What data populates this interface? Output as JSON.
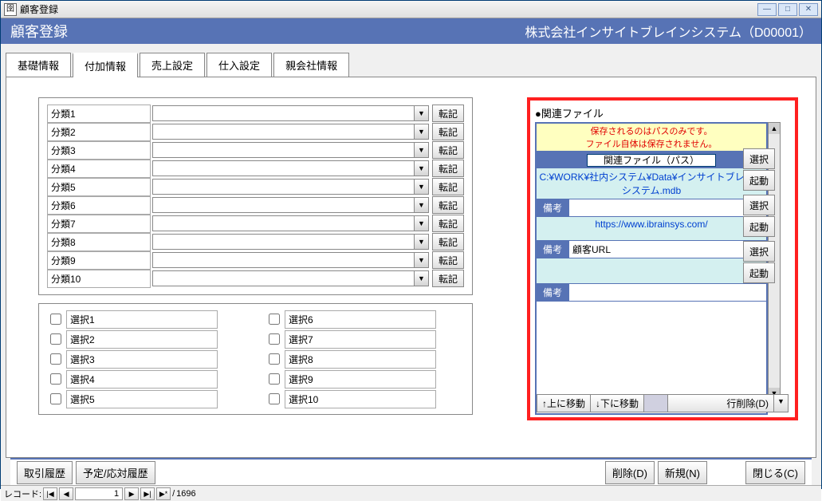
{
  "window": {
    "icon_glyph": "囹",
    "title": "顧客登録",
    "min_glyph": "—",
    "max_glyph": "□",
    "close_glyph": "✕"
  },
  "banner": {
    "title": "顧客登録",
    "company": "株式会社インサイトブレインシステム（D00001）"
  },
  "tabs": [
    {
      "label": "基礎情報"
    },
    {
      "label": "付加情報"
    },
    {
      "label": "売上設定"
    },
    {
      "label": "仕入設定"
    },
    {
      "label": "親会社情報"
    }
  ],
  "active_tab_index": 1,
  "classifications": [
    {
      "label": "分類1",
      "value": ""
    },
    {
      "label": "分類2",
      "value": ""
    },
    {
      "label": "分類3",
      "value": ""
    },
    {
      "label": "分類4",
      "value": ""
    },
    {
      "label": "分類5",
      "value": ""
    },
    {
      "label": "分類6",
      "value": ""
    },
    {
      "label": "分類7",
      "value": ""
    },
    {
      "label": "分類8",
      "value": ""
    },
    {
      "label": "分類9",
      "value": ""
    },
    {
      "label": "分類10",
      "value": ""
    }
  ],
  "tenki_label": "転記",
  "selections": {
    "left": [
      "選択1",
      "選択2",
      "選択3",
      "選択4",
      "選択5"
    ],
    "right": [
      "選択6",
      "選択7",
      "選択8",
      "選択9",
      "選択10"
    ]
  },
  "related": {
    "header": "●関連ファイル",
    "warn1": "保存されるのはパスのみです。",
    "warn2": "ファイル自体は保存されません。",
    "col_header": "関連ファイル（パス）",
    "rows": [
      {
        "path": "C:¥WORK¥社内システム¥Data¥インサイトブレインシステム.mdb",
        "biko_label": "備考",
        "biko": ""
      },
      {
        "path": "https://www.ibrainsys.com/",
        "biko_label": "備考",
        "biko": "顧客URL"
      },
      {
        "path": "",
        "biko_label": "備考",
        "biko": ""
      }
    ],
    "side_buttons": {
      "select": "選択",
      "launch": "起動"
    },
    "bottom": {
      "move_up": "↑上に移動",
      "move_down": "↓下に移動",
      "delete_row": "行削除(D)"
    }
  },
  "footer": {
    "history": "取引履歴",
    "schedule": "予定/応対履歴",
    "delete": "削除(D)",
    "new": "新規(N)",
    "close": "閉じる(C)"
  },
  "record": {
    "label": "レコード:",
    "current": "1",
    "total": "1696",
    "first_glyph": "|◀",
    "prev_glyph": "◀",
    "next_glyph": "▶",
    "last_glyph": "▶|",
    "new_glyph": "▶*",
    "sep": " / "
  }
}
